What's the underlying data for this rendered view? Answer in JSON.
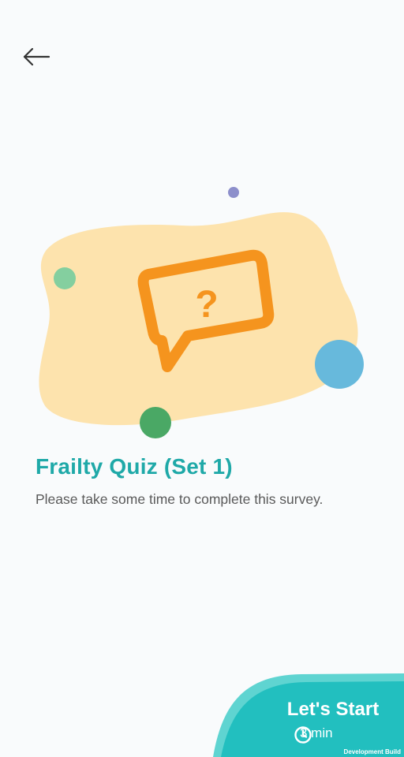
{
  "header": {
    "back_icon": "arrow-left-icon"
  },
  "illustration": {
    "icon": "question-speech-bubble-icon",
    "question_mark": "?",
    "colors": {
      "blob": "#fde3ad",
      "bubble": "#f5941e",
      "dot_purple": "#8d8fcb",
      "dot_light_green": "#84cf9f",
      "dot_blue": "#67b9dc",
      "dot_green": "#4aa865"
    }
  },
  "quiz": {
    "title": "Frailty Quiz (Set 1)",
    "description": "Please take some time to complete this survey."
  },
  "start_button": {
    "label": "Let's Start",
    "duration": "3 min",
    "clock_icon": "clock-icon"
  },
  "footer": {
    "build_label": "Development Build"
  },
  "theme": {
    "accent": "#1fa9a8",
    "button_bg": "#22bfbf",
    "button_light": "#5fd4d1",
    "text_secondary": "#5a5a5a"
  }
}
